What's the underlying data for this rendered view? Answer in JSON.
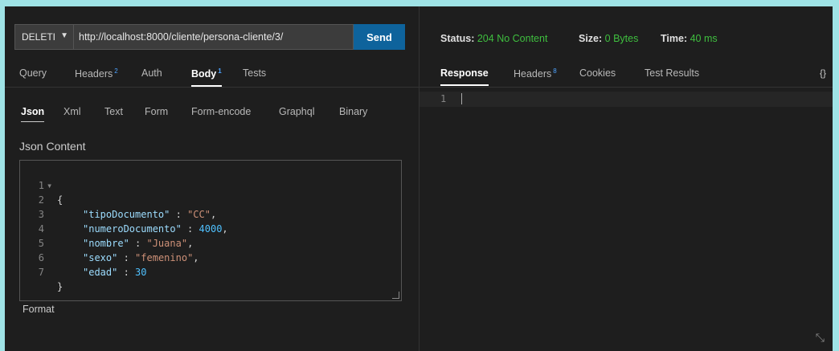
{
  "request": {
    "method": "DELETI",
    "url": "http://localhost:8000/cliente/persona-cliente/3/",
    "send_label": "Send"
  },
  "request_tabs": [
    {
      "label": "Query",
      "badge": ""
    },
    {
      "label": "Headers",
      "badge": "2"
    },
    {
      "label": "Auth",
      "badge": ""
    },
    {
      "label": "Body",
      "badge": "1"
    },
    {
      "label": "Tests",
      "badge": ""
    }
  ],
  "body_tabs": [
    "Json",
    "Xml",
    "Text",
    "Form",
    "Form-encode",
    "Graphql",
    "Binary"
  ],
  "json_label": "Json Content",
  "editor": {
    "line_numbers": [
      "1",
      "2",
      "3",
      "4",
      "5",
      "6",
      "7"
    ],
    "fold_marker": "▾",
    "lines": {
      "l1": "{",
      "l2_key": "\"tipoDocumento\"",
      "l2_sep": " : ",
      "l2_val": "\"CC\"",
      "l2_end": ",",
      "l3_key": "\"numeroDocumento\"",
      "l3_sep": " : ",
      "l3_val": "4000",
      "l3_end": ",",
      "l4_key": "\"nombre\"",
      "l4_sep": " : ",
      "l4_val": "\"Juana\"",
      "l4_end": ",",
      "l5_key": "\"sexo\"",
      "l5_sep": " : ",
      "l5_val": "\"femenino\"",
      "l5_end": ",",
      "l6_key": "\"edad\"",
      "l6_sep": " : ",
      "l6_val": "30",
      "l7": "}"
    }
  },
  "format_label": "Format",
  "response": {
    "status_label": "Status:",
    "status_value": "204 No Content",
    "size_label": "Size:",
    "size_value": "0 Bytes",
    "time_label": "Time:",
    "time_value": "40 ms",
    "tabs": [
      {
        "label": "Response",
        "badge": ""
      },
      {
        "label": "Headers",
        "badge": "8"
      },
      {
        "label": "Cookies",
        "badge": ""
      },
      {
        "label": "Test Results",
        "badge": ""
      }
    ],
    "braces": "{}",
    "line_number": "1"
  },
  "colors": {
    "accent": "#0e639c",
    "status_ok": "#3fbf3f",
    "badge": "#4da3ff",
    "outer_border": "#9fe3e6"
  },
  "icons": {
    "method_dropdown": "chevron-down-icon",
    "expand": "expand-icon"
  }
}
